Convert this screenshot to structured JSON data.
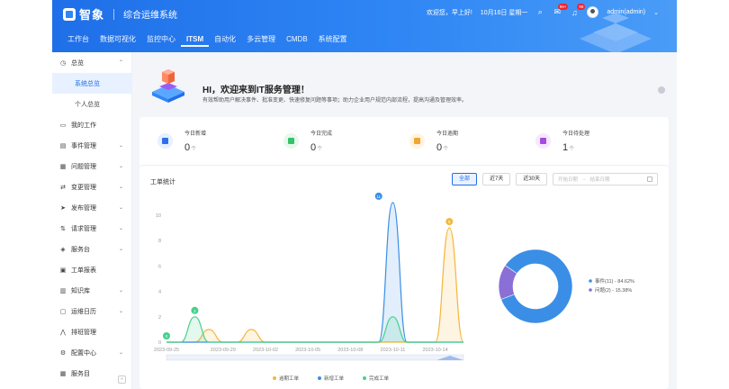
{
  "header": {
    "logo_text": "智象",
    "system_title": "综合运维系统",
    "greeting": "欢迎您，早上好!",
    "date": "10月16日 星期一",
    "badge_1": "99+",
    "badge_2": "99",
    "user": "admin(admin)",
    "chevron": "⌄"
  },
  "nav": [
    "工作台",
    "数据可视化",
    "监控中心",
    "ITSM",
    "自动化",
    "多云管理",
    "CMDB",
    "系统配置"
  ],
  "sidebar": {
    "items": [
      {
        "label": "总览",
        "icon": "clock-icon",
        "glyph": "◷",
        "arrow": "⌃"
      },
      {
        "label": "我的工作",
        "icon": "monitor-icon",
        "glyph": "▭"
      },
      {
        "label": "事件管理",
        "icon": "event-icon",
        "glyph": "▤",
        "arrow": "⌄"
      },
      {
        "label": "问题管理",
        "icon": "grid-icon",
        "glyph": "▦",
        "arrow": "⌄"
      },
      {
        "label": "变更管理",
        "icon": "change-icon",
        "glyph": "⇄",
        "arrow": "⌄"
      },
      {
        "label": "发布管理",
        "icon": "send-icon",
        "glyph": "➤",
        "arrow": "⌄"
      },
      {
        "label": "请求管理",
        "icon": "request-icon",
        "glyph": "⇅",
        "arrow": "⌄"
      },
      {
        "label": "服务台",
        "icon": "box-icon",
        "glyph": "◈",
        "arrow": "⌄"
      },
      {
        "label": "工单报表",
        "icon": "report-icon",
        "glyph": "▣"
      },
      {
        "label": "知识库",
        "icon": "book-icon",
        "glyph": "▥",
        "arrow": "⌄"
      },
      {
        "label": "运维日历",
        "icon": "calendar-icon",
        "glyph": "▢",
        "arrow": "⌄"
      },
      {
        "label": "排班管理",
        "icon": "schedule-icon",
        "glyph": "⋀"
      },
      {
        "label": "配置中心",
        "icon": "settings-icon",
        "glyph": "⚙",
        "arrow": "⌄"
      },
      {
        "label": "服务目",
        "icon": "catalog-icon",
        "glyph": "▦"
      }
    ],
    "sub_items": [
      "系统总览",
      "个人总览"
    ],
    "collapse_glyph": "«"
  },
  "welcome": {
    "title": "HI，欢迎来到IT服务管理！",
    "subtitle": "有效帮助用户解决事件、批准变更、快速修复问题等事项；助力企业用户规范内部流程，提高沟通及管理效率。"
  },
  "stats": [
    {
      "label": "今日新增",
      "value": "0",
      "unit": "个",
      "icon": "plus-doc-icon",
      "bg": "#e6f0ff",
      "fg": "#2f6fe8"
    },
    {
      "label": "今日完成",
      "value": "0",
      "unit": "个",
      "icon": "done-icon",
      "bg": "#e7f8ec",
      "fg": "#36c26b"
    },
    {
      "label": "今日逾期",
      "value": "0",
      "unit": "个",
      "icon": "overdue-icon",
      "bg": "#fff4df",
      "fg": "#f2a531"
    },
    {
      "label": "今日待处理",
      "value": "1",
      "unit": "个",
      "icon": "hourglass-icon",
      "bg": "#f5e8ff",
      "fg": "#a44be0"
    }
  ],
  "chart_section": {
    "title": "工单统计",
    "filters": [
      "全部",
      "近7天",
      "近30天"
    ],
    "active_filter": "全部",
    "start_placeholder": "开始日期",
    "separator": "→",
    "end_placeholder": "结束日期"
  },
  "chart_data": [
    {
      "type": "area",
      "x": [
        "2023-09-25",
        "2023-09-26",
        "2023-09-27",
        "2023-09-28",
        "2023-09-29",
        "2023-09-30",
        "2023-10-01",
        "2023-10-02",
        "2023-10-03",
        "2023-10-04",
        "2023-10-05",
        "2023-10-06",
        "2023-10-07",
        "2023-10-08",
        "2023-10-09",
        "2023-10-10",
        "2023-10-11",
        "2023-10-12",
        "2023-10-13",
        "2023-10-14",
        "2023-10-15",
        "2023-10-16"
      ],
      "xticks": [
        "2023-09-25",
        "2023-09-29",
        "2023-10-02",
        "2023-10-05",
        "2023-10-08",
        "2023-10-11",
        "2023-10-14"
      ],
      "ylim": [
        0,
        10
      ],
      "yticks": [
        0,
        2,
        4,
        6,
        8,
        10
      ],
      "series": [
        {
          "name": "逾期工单",
          "color": "#f4b63a",
          "values": [
            0,
            0,
            0,
            1,
            0,
            0,
            1,
            0,
            0,
            0,
            0,
            0,
            0,
            0,
            0,
            0,
            0,
            0,
            0,
            0,
            9,
            0
          ]
        },
        {
          "name": "新增工单",
          "color": "#3a8ee6",
          "values": [
            0,
            0,
            0,
            0,
            0,
            0,
            0,
            0,
            0,
            0,
            0,
            0,
            0,
            0,
            0,
            0,
            11,
            0,
            0,
            0,
            0,
            0
          ]
        },
        {
          "name": "完成工单",
          "color": "#45d18a",
          "values": [
            0,
            0,
            2,
            0,
            0,
            0,
            0,
            0,
            0,
            0,
            0,
            0,
            0,
            0,
            0,
            0,
            2,
            0,
            0,
            0,
            0,
            0
          ]
        }
      ],
      "point_labels": [
        {
          "series": "完成工单",
          "x": "2023-09-25",
          "y": 0,
          "text": "0"
        },
        {
          "series": "完成工单",
          "x": "2023-09-27",
          "y": 2,
          "text": "2"
        },
        {
          "series": "新增工单",
          "x": "2023-10-10",
          "y": 11,
          "text": "11"
        },
        {
          "series": "逾期工单",
          "x": "2023-10-15",
          "y": 9,
          "text": "9"
        }
      ],
      "legend_position": "bottom"
    },
    {
      "type": "pie",
      "style": "donut",
      "slices": [
        {
          "label": "事件(11) - 84.62%",
          "value": 84.62,
          "color": "#3a8ee6"
        },
        {
          "label": "问题(2) - 15.38%",
          "value": 15.38,
          "color": "#8a6fd6"
        }
      ],
      "legend_position": "right"
    }
  ]
}
